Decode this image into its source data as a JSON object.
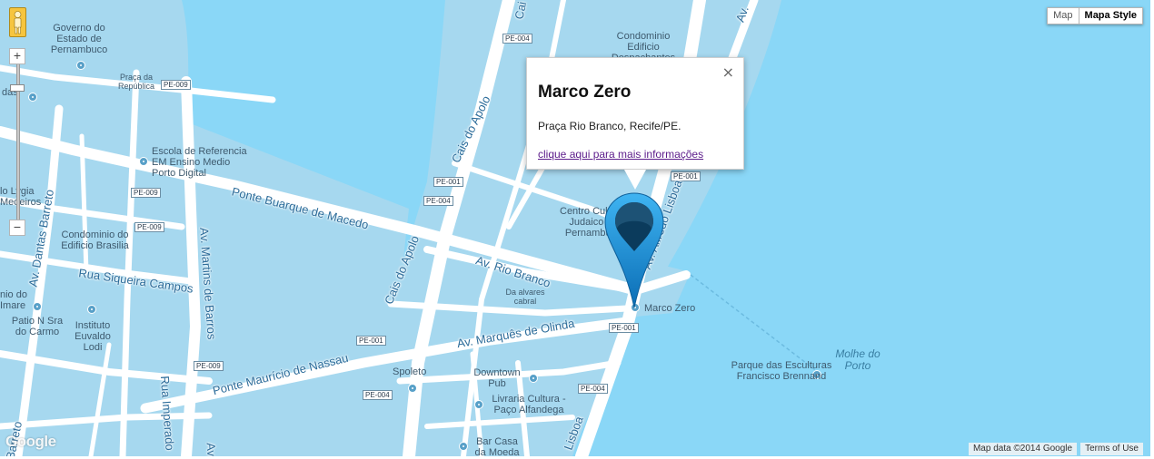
{
  "map_controls": {
    "type_map": "Map",
    "type_style": "Mapa Style",
    "zoom_in": "+",
    "zoom_out": "−",
    "logo": "Google",
    "map_data": "Map data ©2014 Google",
    "terms": "Terms of Use"
  },
  "info_window": {
    "title": "Marco Zero",
    "address": "Praça Rio Branco, Recife/PE.",
    "link": "clique aqui para mais informações",
    "close": "×"
  },
  "marker": {
    "label": "Marco Zero",
    "color": "#1b8fd6"
  },
  "colors": {
    "water": "#8ad7f7",
    "land": "#a6d8ef",
    "road": "#ffffff"
  },
  "labels": {
    "governo": "Governo do Estado de Pernambuco",
    "praca_republica": "Praça da República",
    "escola": "Escola de Referencia EM Ensino Medio Porto Digital",
    "condominio_brasilia": "Condominio do Edificio Brasilia",
    "condominio_despachantes": "Condominio Edificio Despachantes Aduaneiros",
    "centro_cultural": "Centro Cultural Judaico de Pernambuco",
    "da_alvares": "Da alvares cabral",
    "instituto": "Instituto Euvaldo Lodi",
    "patio": "Patio N Sra do Carmo",
    "spoleto": "Spoleto",
    "downtown": "Downtown Pub",
    "livraria": "Livraria Cultura - Paço Alfandega",
    "bar_casa": "Bar Casa da Moeda",
    "parque": "Parque das Esculturas Francisco Brennand",
    "molhe": "Molhe do Porto",
    "marco_zero": "Marco Zero",
    "lygia": "lo Lygia Medeiros",
    "imare": "nio do Imare",
    "das": "das"
  },
  "streets": {
    "ponte_buarque": "Ponte Buarque de Macedo",
    "cais_apolo_1": "Cais do Apolo",
    "cais_apolo_2": "Cais do Apolo",
    "av_rio_branco": "Av. Rio Branco",
    "av_alfredo_lisboa": "Av. Alfredo Lisboa",
    "av_dantas_barreto": "Av. Dantas Barreto",
    "rua_siqueira": "Rua Siqueira Campos",
    "av_martins": "Av. Martins de Barros",
    "rua_imperador": "Rua Imperado",
    "av_marques": "Av. Marquês de Olinda",
    "ponte_mauricio": "Ponte Maurício de Nassau",
    "lisboa_bottom": "Lisboa",
    "barreto_bottom": "Barreto",
    "av_top": "Av.",
    "cai_top": "Cai",
    "av_bottom": "Av"
  },
  "shields": {
    "pe004_a": "PE-004",
    "pe009_a": "PE-009",
    "pe001_a": "PE-001",
    "pe004_b": "PE-004",
    "pe009_b": "PE-009",
    "pe009_c": "PE-009",
    "pe001_b": "PE-001",
    "pe001_c": "PE-001",
    "pe009_d": "PE-009",
    "pe004_c": "PE-004",
    "pe004_d": "PE-004",
    "pe001_d": "PE-001"
  }
}
